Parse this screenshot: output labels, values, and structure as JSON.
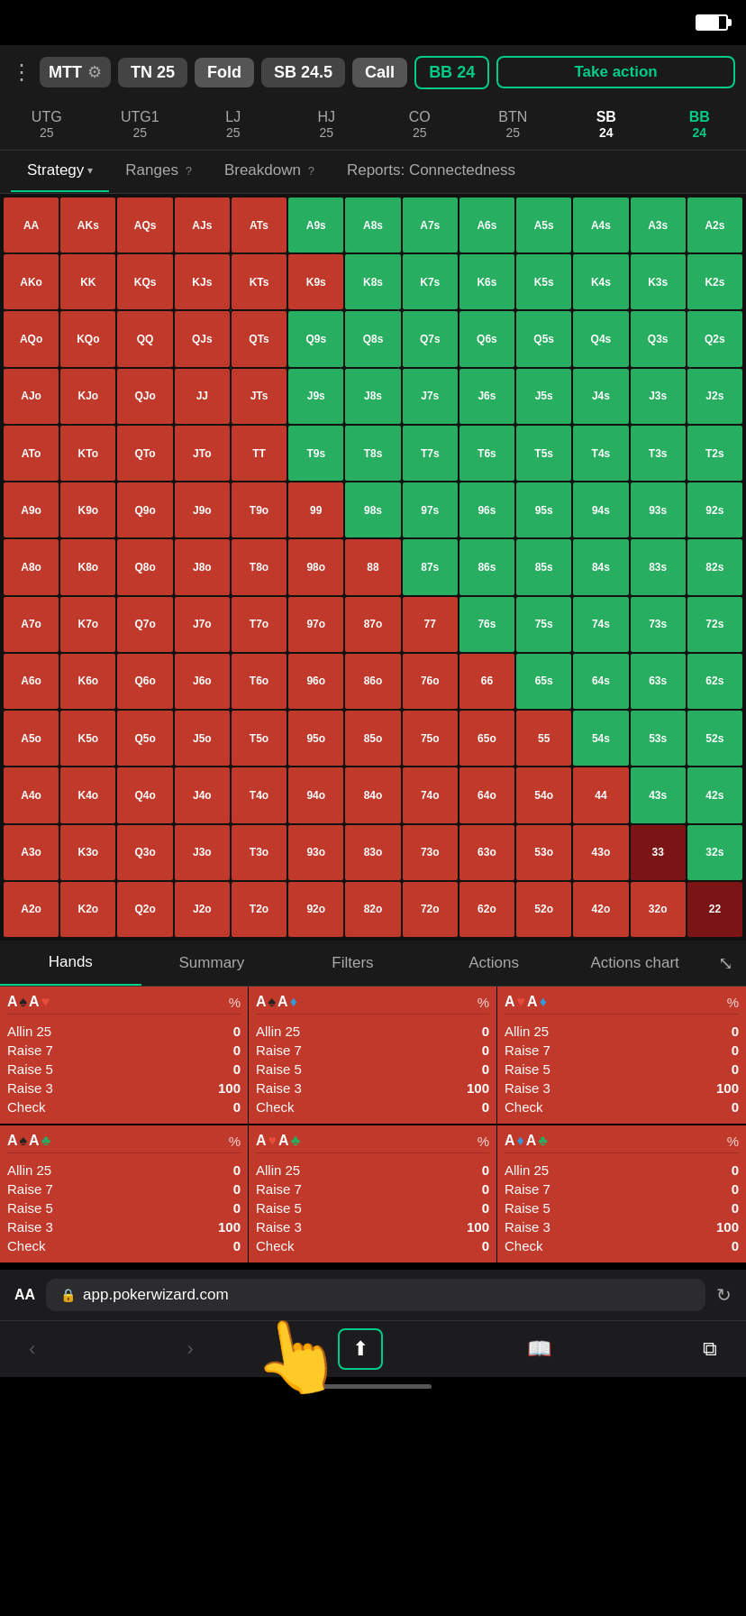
{
  "statusBar": {
    "batteryLevel": 75
  },
  "toolbar": {
    "menuLabel": "⋮",
    "mttLabel": "MTT",
    "gearLabel": "⚙",
    "tnLabel": "TN",
    "tnStack": "25",
    "foldLabel": "Fold",
    "sbLabel": "SB",
    "sbStack": "24.5",
    "callLabel": "Call",
    "bbLabel": "BB",
    "bbStack": "24",
    "takeActionLabel": "Take action"
  },
  "positions": [
    {
      "id": "utg",
      "label": "UTG",
      "stack": "25"
    },
    {
      "id": "utg1",
      "label": "UTG1",
      "stack": "25"
    },
    {
      "id": "lj",
      "label": "LJ",
      "stack": "25"
    },
    {
      "id": "hj",
      "label": "HJ",
      "stack": "25"
    },
    {
      "id": "co",
      "label": "CO",
      "stack": "25"
    },
    {
      "id": "btn",
      "label": "BTN",
      "stack": "25"
    },
    {
      "id": "sb",
      "label": "SB",
      "stack": "24",
      "active": "sb"
    },
    {
      "id": "bb",
      "label": "BB",
      "stack": "24",
      "active": "bb"
    }
  ],
  "navTabs": {
    "strategy": "Strategy",
    "ranges": "Ranges",
    "breakdown": "Breakdown",
    "reports": "Reports: Connectedness"
  },
  "matrix": {
    "labels": [
      "AA",
      "AKs",
      "AQs",
      "AJs",
      "ATs",
      "A9s",
      "A8s",
      "A7s",
      "A6s",
      "A5s",
      "A4s",
      "A3s",
      "A2s",
      "AKo",
      "KK",
      "KQs",
      "KJs",
      "KTs",
      "K9s",
      "K8s",
      "K7s",
      "K6s",
      "K5s",
      "K4s",
      "K3s",
      "K2s",
      "AQo",
      "KQo",
      "QQ",
      "QJs",
      "QTs",
      "Q9s",
      "Q8s",
      "Q7s",
      "Q6s",
      "Q5s",
      "Q4s",
      "Q3s",
      "Q2s",
      "AJo",
      "KJo",
      "QJo",
      "JJ",
      "JTs",
      "J9s",
      "J8s",
      "J7s",
      "J6s",
      "J5s",
      "J4s",
      "J3s",
      "J2s",
      "ATo",
      "KTo",
      "QTo",
      "JTo",
      "TT",
      "T9s",
      "T8s",
      "T7s",
      "T6s",
      "T5s",
      "T4s",
      "T3s",
      "T2s",
      "A9o",
      "K9o",
      "Q9o",
      "J9o",
      "T9o",
      "99",
      "98s",
      "97s",
      "96s",
      "95s",
      "94s",
      "93s",
      "92s",
      "A8o",
      "K8o",
      "Q8o",
      "J8o",
      "T8o",
      "98o",
      "88",
      "87s",
      "86s",
      "85s",
      "84s",
      "83s",
      "82s",
      "A7o",
      "K7o",
      "Q7o",
      "J7o",
      "T7o",
      "97o",
      "87o",
      "77",
      "76s",
      "75s",
      "74s",
      "73s",
      "72s",
      "A6o",
      "K6o",
      "Q6o",
      "J6o",
      "T6o",
      "96o",
      "86o",
      "76o",
      "66",
      "65s",
      "64s",
      "63s",
      "62s",
      "A5o",
      "K5o",
      "Q5o",
      "J5o",
      "T5o",
      "95o",
      "85o",
      "75o",
      "65o",
      "55",
      "54s",
      "53s",
      "52s",
      "A4o",
      "K4o",
      "Q4o",
      "J4o",
      "T4o",
      "94o",
      "84o",
      "74o",
      "64o",
      "54o",
      "44",
      "43s",
      "42s",
      "A3o",
      "K3o",
      "Q3o",
      "J3o",
      "T3o",
      "93o",
      "83o",
      "73o",
      "63o",
      "53o",
      "43o",
      "33",
      "32s",
      "A2o",
      "K2o",
      "Q2o",
      "J2o",
      "T2o",
      "92o",
      "82o",
      "72o",
      "62o",
      "52o",
      "42o",
      "32o",
      "22"
    ],
    "colors": [
      "r",
      "r",
      "r",
      "r",
      "r",
      "g",
      "g",
      "g",
      "g",
      "g",
      "g",
      "g",
      "g",
      "r",
      "r",
      "r",
      "r",
      "r",
      "r",
      "g",
      "g",
      "g",
      "g",
      "g",
      "g",
      "g",
      "r",
      "r",
      "r",
      "r",
      "r",
      "g",
      "g",
      "g",
      "g",
      "g",
      "g",
      "g",
      "g",
      "r",
      "r",
      "r",
      "r",
      "r",
      "g",
      "g",
      "g",
      "g",
      "g",
      "g",
      "g",
      "g",
      "r",
      "r",
      "r",
      "r",
      "r",
      "g",
      "g",
      "g",
      "g",
      "g",
      "g",
      "g",
      "g",
      "r",
      "r",
      "r",
      "r",
      "r",
      "r",
      "g",
      "g",
      "g",
      "g",
      "g",
      "g",
      "g",
      "r",
      "r",
      "r",
      "r",
      "r",
      "r",
      "r",
      "g",
      "g",
      "g",
      "g",
      "g",
      "g",
      "r",
      "r",
      "r",
      "r",
      "r",
      "r",
      "r",
      "r",
      "g",
      "g",
      "g",
      "g",
      "g",
      "r",
      "r",
      "r",
      "r",
      "r",
      "r",
      "r",
      "r",
      "r",
      "g",
      "g",
      "g",
      "g",
      "r",
      "r",
      "r",
      "r",
      "r",
      "r",
      "r",
      "r",
      "r",
      "r",
      "g",
      "g",
      "g",
      "r",
      "r",
      "r",
      "r",
      "r",
      "r",
      "r",
      "r",
      "r",
      "r",
      "r",
      "g",
      "g",
      "r",
      "r",
      "r",
      "r",
      "r",
      "r",
      "r",
      "r",
      "r",
      "r",
      "r",
      "dr",
      "g",
      "r",
      "r",
      "r",
      "r",
      "r",
      "r",
      "r",
      "r",
      "r",
      "r",
      "r",
      "r",
      "dr"
    ]
  },
  "bottomTabs": {
    "hands": "Hands",
    "summary": "Summary",
    "filters": "Filters",
    "actions": "Actions",
    "actionsChart": "Actions chart"
  },
  "handsRows": [
    {
      "cols": [
        {
          "combo": "A♠A♥",
          "pct": "%",
          "actions": [
            {
              "label": "Allin 25",
              "val": "0"
            },
            {
              "label": "Raise 7",
              "val": "0"
            },
            {
              "label": "Raise 5",
              "val": "0"
            },
            {
              "label": "Raise 3",
              "val": "100"
            },
            {
              "label": "Check",
              "val": "0"
            }
          ]
        },
        {
          "combo": "A♠A♦",
          "pct": "%",
          "actions": [
            {
              "label": "Allin 25",
              "val": "0"
            },
            {
              "label": "Raise 7",
              "val": "0"
            },
            {
              "label": "Raise 5",
              "val": "0"
            },
            {
              "label": "Raise 3",
              "val": "100"
            },
            {
              "label": "Check",
              "val": "0"
            }
          ]
        },
        {
          "combo": "A♥A♦",
          "pct": "%",
          "actions": [
            {
              "label": "Allin 25",
              "val": "0"
            },
            {
              "label": "Raise 7",
              "val": "0"
            },
            {
              "label": "Raise 5",
              "val": "0"
            },
            {
              "label": "Raise 3",
              "val": "100"
            },
            {
              "label": "Check",
              "val": "0"
            }
          ]
        }
      ]
    },
    {
      "cols": [
        {
          "combo": "A♠A♣",
          "pct": "%",
          "actions": [
            {
              "label": "Allin 25",
              "val": "0"
            },
            {
              "label": "Raise 7",
              "val": "0"
            },
            {
              "label": "Raise 5",
              "val": "0"
            },
            {
              "label": "Raise 3",
              "val": "100"
            },
            {
              "label": "Check",
              "val": "0"
            }
          ]
        },
        {
          "combo": "A♥A♣",
          "pct": "%",
          "actions": [
            {
              "label": "Allin 25",
              "val": "0"
            },
            {
              "label": "Raise 7",
              "val": "0"
            },
            {
              "label": "Raise 5",
              "val": "0"
            },
            {
              "label": "Raise 3",
              "val": "100"
            },
            {
              "label": "Check",
              "val": "0"
            }
          ]
        },
        {
          "combo": "A♦A♣",
          "pct": "%",
          "actions": [
            {
              "label": "Allin 25",
              "val": "0"
            },
            {
              "label": "Raise 7",
              "val": "0"
            },
            {
              "label": "Raise 5",
              "val": "0"
            },
            {
              "label": "Raise 3",
              "val": "100"
            },
            {
              "label": "Check",
              "val": "0"
            }
          ]
        }
      ]
    }
  ],
  "browserBar": {
    "aaLabel": "AA",
    "lockIcon": "🔒",
    "url": "app.pokerwizard.com",
    "reloadIcon": "↻"
  },
  "iosNav": {
    "backLabel": "‹",
    "forwardLabel": "›",
    "shareLabel": "⬆",
    "bookmarkLabel": "📖",
    "tabsLabel": "⧉"
  }
}
